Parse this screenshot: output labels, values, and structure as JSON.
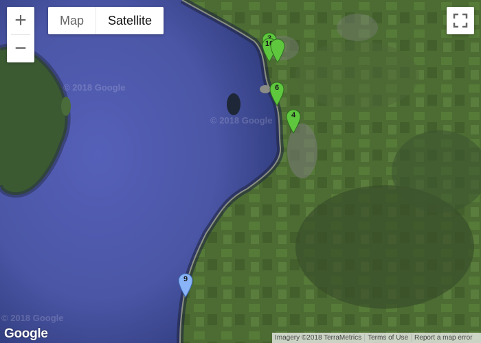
{
  "map": {
    "type_controls": {
      "map_label": "Map",
      "satellite_label": "Satellite",
      "selected": "Satellite"
    },
    "zoom": {
      "in_label": "+",
      "out_label": "−"
    },
    "fullscreen_icon": "fullscreen-icon",
    "logo_text": "Google",
    "watermark_text": "© 2018 Google",
    "attribution": {
      "imagery": "Imagery ©2018 TerraMetrics",
      "terms": "Terms of Use",
      "report": "Report a map error"
    },
    "markers": [
      {
        "label": "3",
        "color": "#5ec73e"
      },
      {
        "label": "10",
        "color": "#5ec73e"
      },
      {
        "label": "6",
        "color": "#5ec73e"
      },
      {
        "label": "4",
        "color": "#5ec73e"
      },
      {
        "label": "9",
        "color": "#8ab4f8"
      }
    ]
  }
}
